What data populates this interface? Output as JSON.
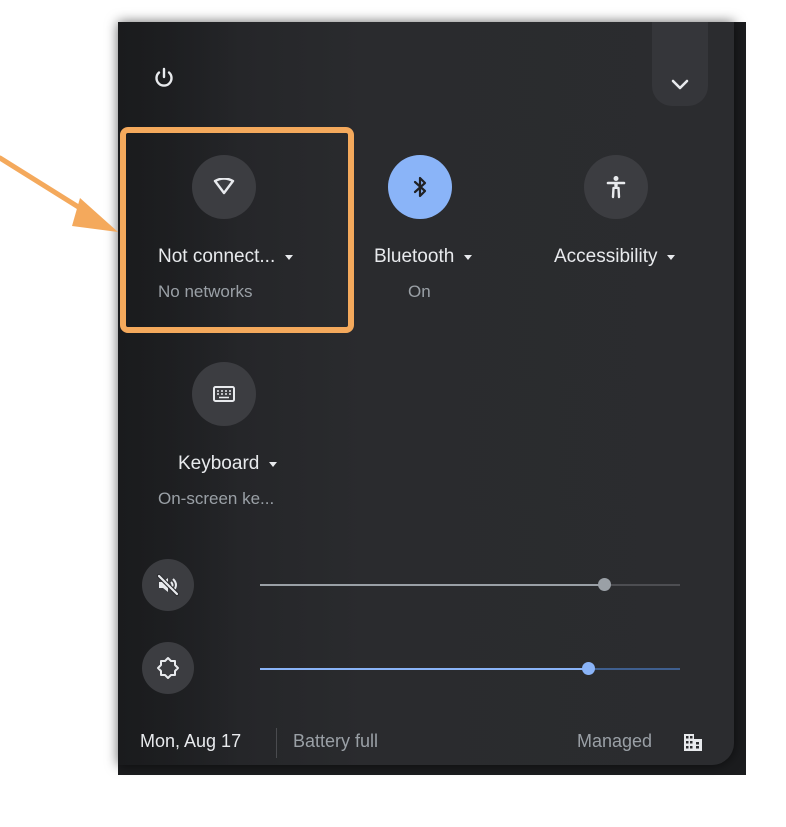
{
  "tiles": {
    "network": {
      "label": "Not connect...",
      "sublabel": "No networks",
      "icon": "wifi-icon"
    },
    "bluetooth": {
      "label": "Bluetooth",
      "sublabel": "On",
      "icon": "bluetooth-icon"
    },
    "accessibility": {
      "label": "Accessibility",
      "icon": "accessibility-icon"
    },
    "keyboard": {
      "label": "Keyboard",
      "sublabel": "On-screen ke...",
      "icon": "keyboard-icon"
    }
  },
  "sliders": {
    "volume": {
      "icon": "volume-muted-icon",
      "level": 0.82
    },
    "brightness": {
      "icon": "brightness-icon",
      "level": 0.78
    }
  },
  "footer": {
    "date": "Mon, Aug 17",
    "battery": "Battery full",
    "managed": "Managed"
  },
  "colors": {
    "accent": "#8ab4f8",
    "highlight": "#f4a95c",
    "panel": "#2b2c2f"
  }
}
